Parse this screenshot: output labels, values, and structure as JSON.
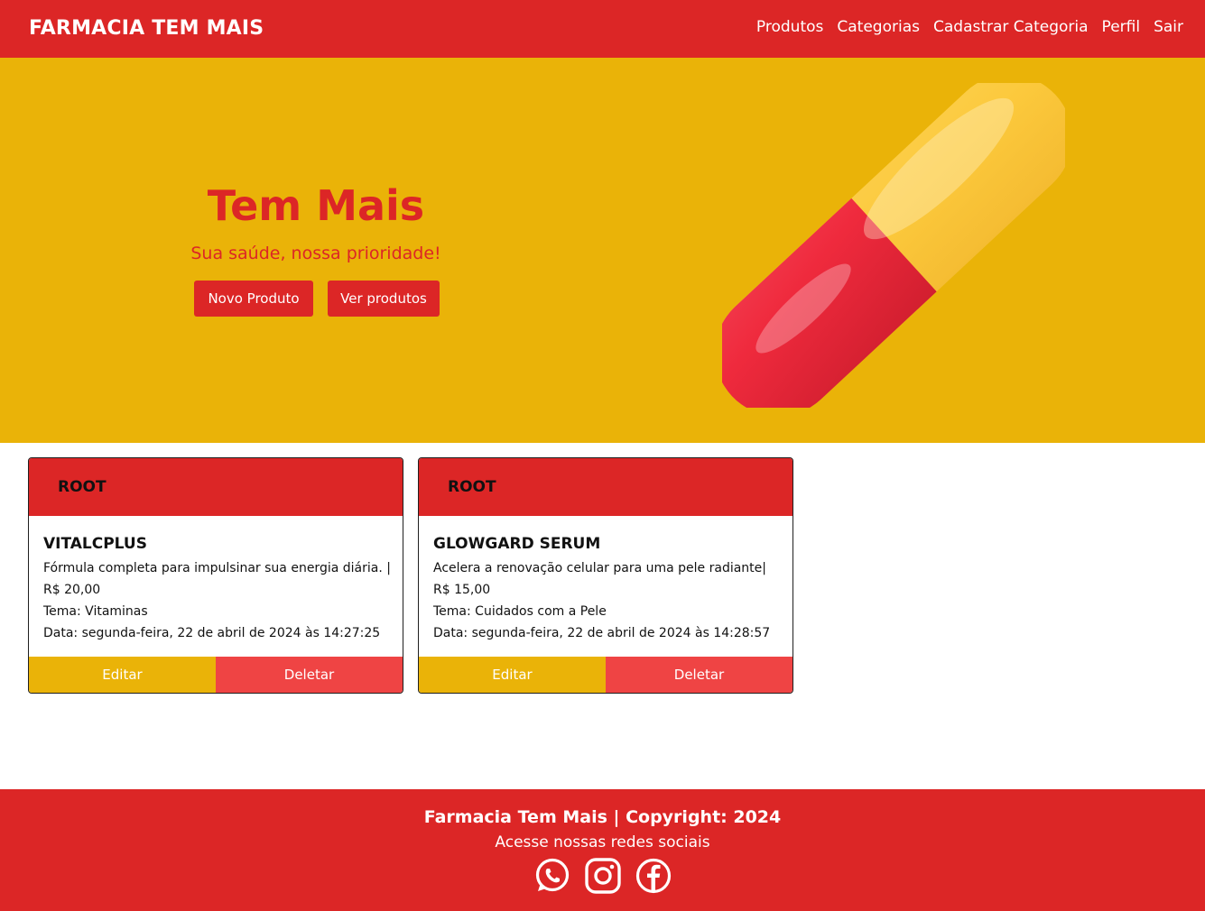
{
  "navbar": {
    "brand": "FARMACIA TEM MAIS",
    "links": [
      "Produtos",
      "Categorias",
      "Cadastrar Categoria",
      "Perfil",
      "Sair"
    ]
  },
  "hero": {
    "title": "Tem Mais",
    "subtitle": "Sua saúde, nossa prioridade!",
    "buttons": {
      "novo_produto": "Novo Produto",
      "ver_produtos": "Ver produtos"
    },
    "image_icon": "pill-capsule"
  },
  "products": [
    {
      "user": "ROOT",
      "name": "VITALCPLUS",
      "description": "Fórmula completa para impulsinar sua energia diária. |",
      "price": "R$ 20,00",
      "theme": "Tema: Vitaminas",
      "date": "Data: segunda-feira, 22 de abril de 2024 às 14:27:25",
      "edit_label": "Editar",
      "delete_label": "Deletar"
    },
    {
      "user": "ROOT",
      "name": "GLOWGARD SERUM",
      "description": "Acelera a renovação celular para uma pele radiante|",
      "price": "R$ 15,00",
      "theme": "Tema: Cuidados com a Pele",
      "date": "Data: segunda-feira, 22 de abril de 2024 às 14:28:57",
      "edit_label": "Editar",
      "delete_label": "Deletar"
    }
  ],
  "footer": {
    "copyright": "Farmacia Tem Mais | Copyright: 2024",
    "social_text": "Acesse nossas redes sociais",
    "social_icons": [
      "whatsapp-icon",
      "instagram-icon",
      "facebook-icon"
    ]
  },
  "colors": {
    "primary_red": "#dc2626",
    "hero_yellow": "#eab308",
    "delete_red": "#ef4444"
  }
}
